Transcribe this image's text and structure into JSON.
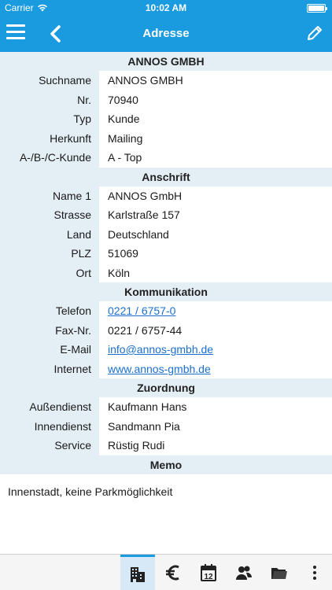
{
  "status_bar": {
    "carrier": "Carrier",
    "time": "10:02 AM"
  },
  "nav": {
    "title": "Adresse"
  },
  "company": {
    "header": "ANNOS GMBH"
  },
  "sections": {
    "general": [
      {
        "label": "Suchname",
        "value": "ANNOS GMBH"
      },
      {
        "label": "Nr.",
        "value": "70940"
      },
      {
        "label": "Typ",
        "value": "Kunde"
      },
      {
        "label": "Herkunft",
        "value": "Mailing"
      },
      {
        "label": "A-/B-/C-Kunde",
        "value": "A - Top"
      }
    ],
    "anschrift": {
      "header": "Anschrift",
      "rows": [
        {
          "label": "Name 1",
          "value": "ANNOS GmbH"
        },
        {
          "label": "Strasse",
          "value": "Karlstraße 157"
        },
        {
          "label": "Land",
          "value": "Deutschland"
        },
        {
          "label": "PLZ",
          "value": "51069"
        },
        {
          "label": "Ort",
          "value": "Köln"
        }
      ]
    },
    "kommunikation": {
      "header": "Kommunikation",
      "rows": [
        {
          "label": "Telefon",
          "value": "0221 / 6757-0"
        },
        {
          "label": "Fax-Nr.",
          "value": "0221 / 6757-44"
        },
        {
          "label": "E-Mail",
          "value": "info@annos-gmbh.de"
        },
        {
          "label": "Internet",
          "value": "www.annos-gmbh.de"
        }
      ]
    },
    "zuordnung": {
      "header": "Zuordnung",
      "rows": [
        {
          "label": "Außendienst",
          "value": "Kaufmann Hans"
        },
        {
          "label": "Innendienst",
          "value": "Sandmann Pia"
        },
        {
          "label": "Service",
          "value": "Rüstig Rudi"
        }
      ]
    },
    "memo": {
      "header": "Memo",
      "text": "Innenstadt, keine Parkmöglichkeit"
    }
  },
  "tabbar": {
    "calendar_day": "12",
    "items": [
      "building-icon",
      "euro-icon",
      "calendar-icon",
      "contacts-icon",
      "folder-icon",
      "more-icon"
    ]
  },
  "colors": {
    "accent": "#1a9be0",
    "label_bg": "#e4eef5",
    "link": "#1a6fd0"
  }
}
